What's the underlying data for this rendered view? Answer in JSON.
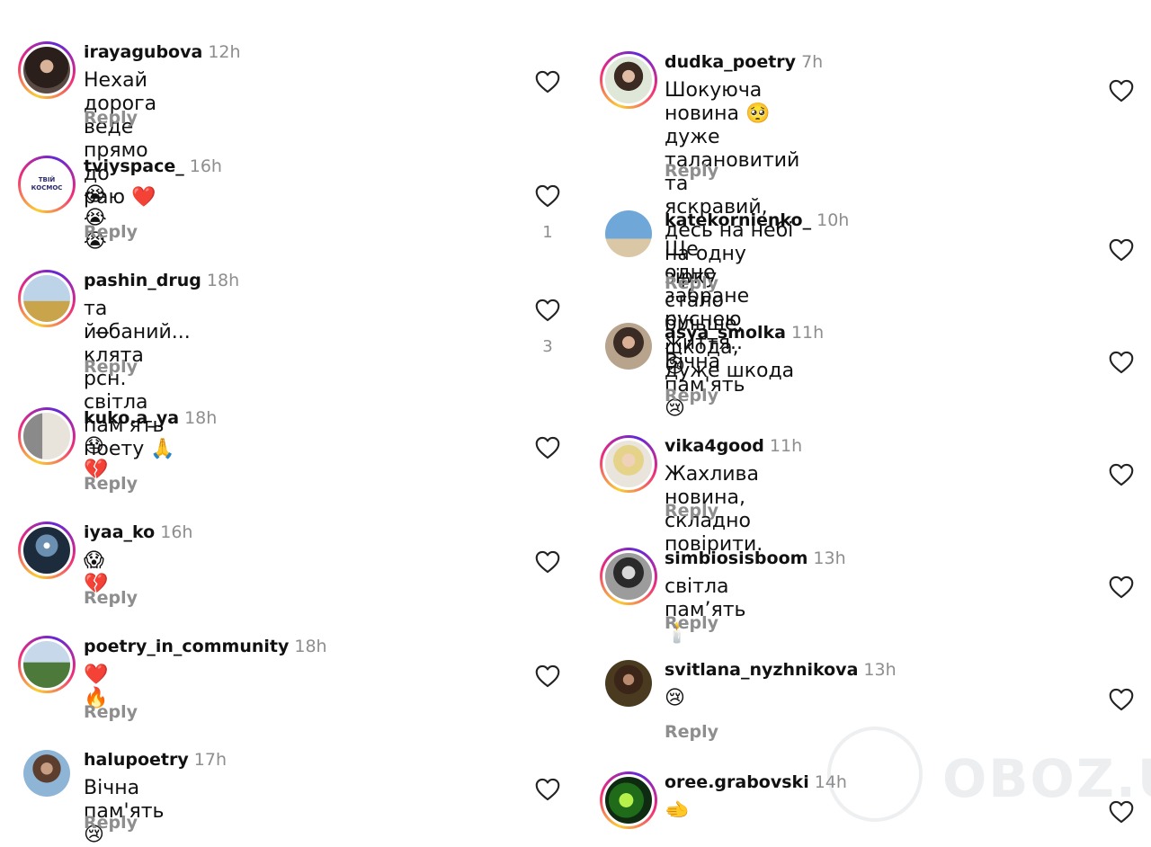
{
  "reply_label": "Reply",
  "watermark": "OBOZ.UA",
  "colors": {
    "username": "#111111",
    "meta": "#8e8e8e",
    "ring_start": "#f9ce34",
    "ring_mid": "#ee2a7b",
    "ring_end": "#6228d7"
  },
  "left_comments": [
    {
      "username": "irayagubova",
      "time": "12h",
      "text": "Нехай дорога веде прямо до раю ❤️",
      "likes": ""
    },
    {
      "username": "tviyspace_",
      "time": "16h",
      "text": "😭😭😭",
      "likes": "1",
      "avatar_text": "ТВІЙ КОСМОС"
    },
    {
      "username": "pashin_drug",
      "time": "18h",
      "text": "та йо̶баний... клята рсн. світла пам'ять\nпоету 🙏",
      "likes": "3"
    },
    {
      "username": "kuko.a_ya",
      "time": "18h",
      "text": "😓💔",
      "likes": ""
    },
    {
      "username": "iyaa_ko",
      "time": "16h",
      "text": "😱💔",
      "likes": ""
    },
    {
      "username": "poetry_in_community",
      "time": "18h",
      "text": "❤️🔥",
      "likes": ""
    },
    {
      "username": "halupoetry",
      "time": "17h",
      "text": "Вічна пам'ять 😢",
      "likes": ""
    }
  ],
  "right_comments": [
    {
      "username": "dudka_poetry",
      "time": "7h",
      "text": "Шокуюча новина 🥺 дуже талановитий та\nяскравий, десь на небі на одну зірку\nстало більше, шкода, дуже шкода",
      "likes": ""
    },
    {
      "username": "katekornienko_",
      "time": "10h",
      "text": "Ще одне забране руснею життя..😢",
      "likes": ""
    },
    {
      "username": "asya_smolka",
      "time": "11h",
      "text": "Вічна пам'ять 😢",
      "likes": ""
    },
    {
      "username": "vika4good",
      "time": "11h",
      "text": "Жахлива новина, складно повірити.",
      "likes": ""
    },
    {
      "username": "simbiosisboom",
      "time": "13h",
      "text": "світла пам’ять 🕯️",
      "likes": ""
    },
    {
      "username": "svitlana_nyzhnikova",
      "time": "13h",
      "text": "😢",
      "likes": ""
    },
    {
      "username": "oree.grabovski",
      "time": "14h",
      "text": "🫲",
      "likes": ""
    }
  ]
}
